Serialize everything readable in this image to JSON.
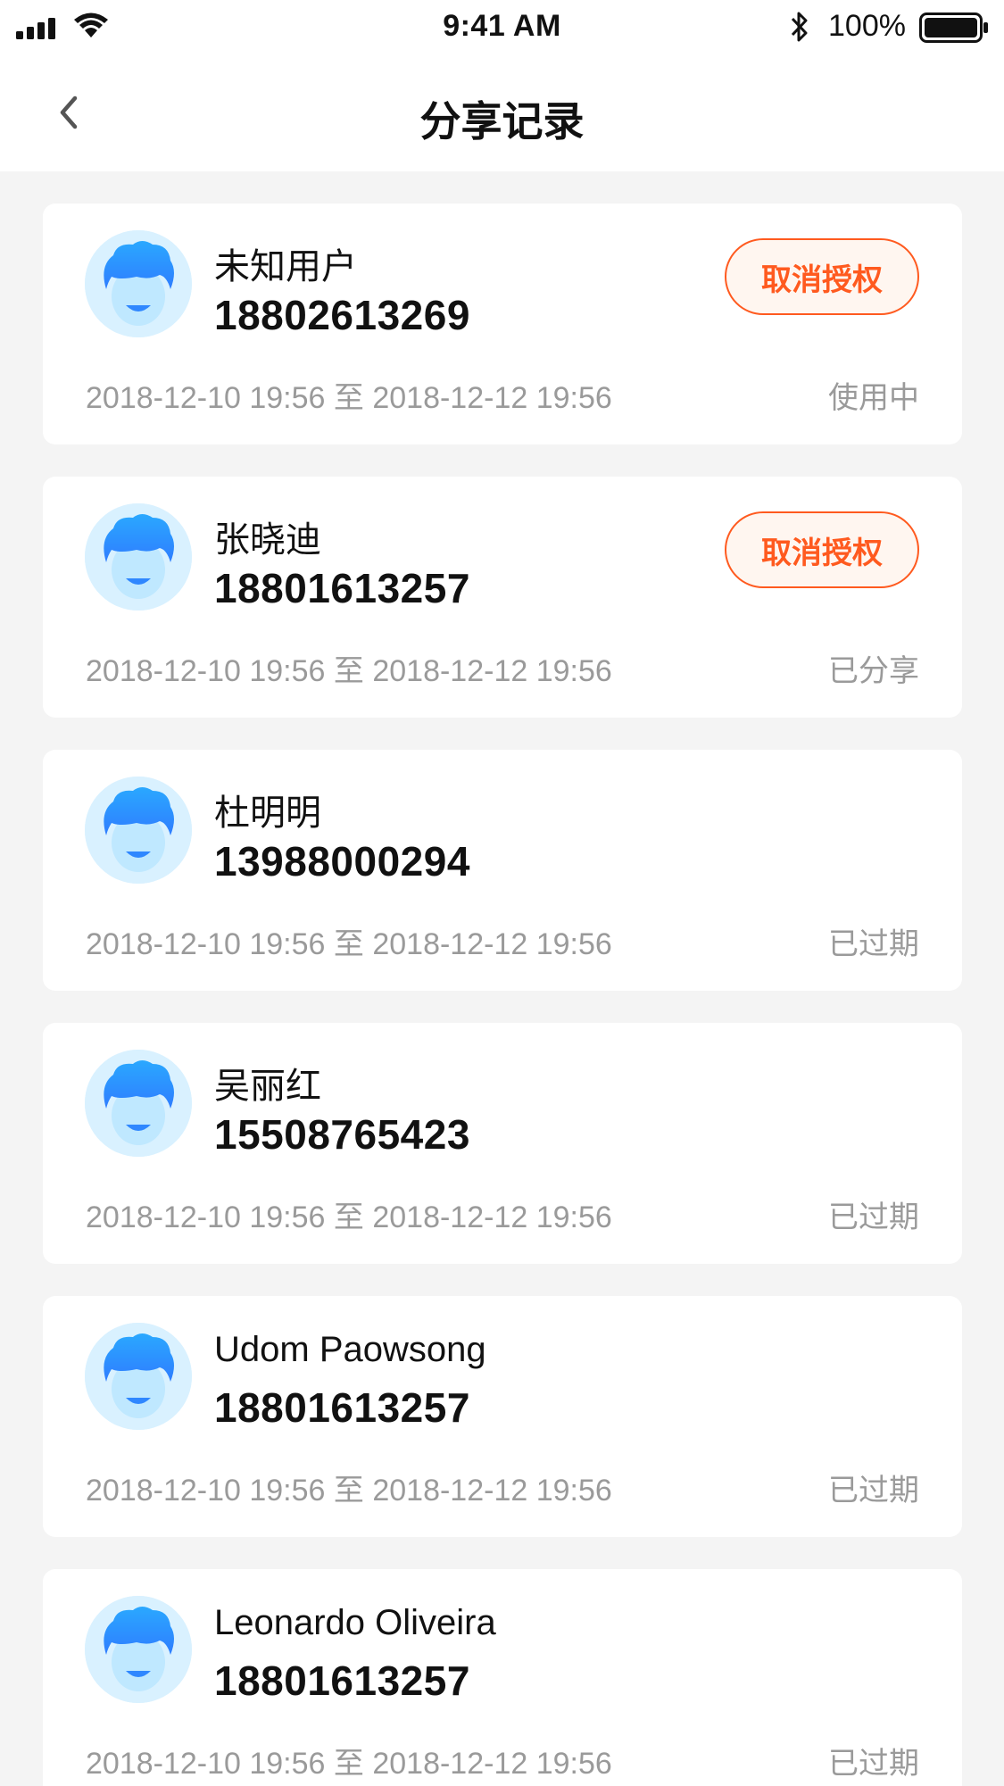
{
  "status_bar": {
    "time": "9:41 AM",
    "battery": "100%",
    "icons": [
      "signal-icon",
      "wifi-icon",
      "bluetooth-icon",
      "battery-icon"
    ]
  },
  "nav": {
    "back_icon": "chevron-left-icon",
    "title": "分享记录"
  },
  "colors": {
    "accent": "#ff5a1f",
    "background": "#f4f4f4",
    "secondary_text": "#9a9a9a",
    "avatar_bg": "#d9f1ff"
  },
  "records": [
    {
      "name": "未知用户",
      "phone": "18802613269",
      "period": "2018-12-10 19:56 至 2018-12-12 19:56",
      "status": "使用中",
      "action": "取消授权"
    },
    {
      "name": "张晓迪",
      "phone": "18801613257",
      "period": "2018-12-10 19:56 至 2018-12-12 19:56",
      "status": "已分享",
      "action": "取消授权"
    },
    {
      "name": "杜明明",
      "phone": "13988000294",
      "period": "2018-12-10 19:56 至 2018-12-12 19:56",
      "status": "已过期"
    },
    {
      "name": "吴丽红",
      "phone": "15508765423",
      "period": "2018-12-10 19:56 至 2018-12-12 19:56",
      "status": "已过期"
    },
    {
      "name": "Udom Paowsong",
      "phone": "18801613257",
      "period": "2018-12-10 19:56 至 2018-12-12 19:56",
      "status": "已过期"
    },
    {
      "name": "Leonardo Oliveira",
      "phone": "18801613257",
      "period": "2018-12-10 19:56 至 2018-12-12 19:56",
      "status": "已过期"
    }
  ]
}
